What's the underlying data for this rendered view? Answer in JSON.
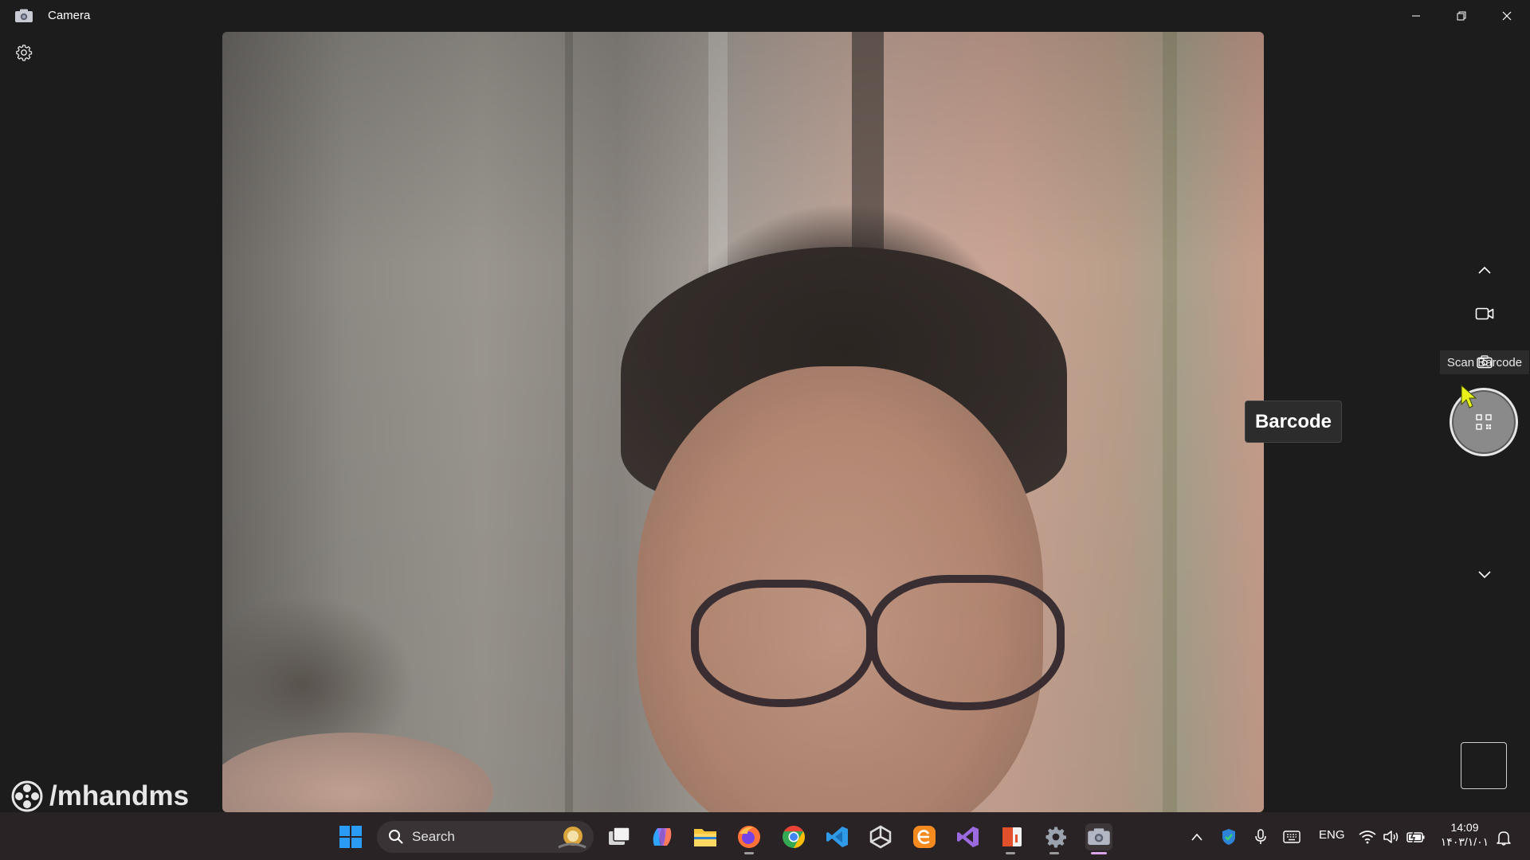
{
  "window": {
    "title": "Camera",
    "controls": [
      "minimize",
      "restore",
      "close"
    ]
  },
  "toolbar": {
    "settings_icon": "gear-icon"
  },
  "camera_preview": {
    "description_icon": "camera-feed"
  },
  "sidebar": {
    "collapse_up_icon": "chevron-up-icon",
    "video_mode_icon": "video-camera-icon",
    "photo_mode_icon": "camera-icon",
    "scan_label": "Scan Barcode",
    "tooltip": "Barcode",
    "shutter_icon": "qr-code-icon",
    "expand_down_icon": "chevron-down-icon",
    "last_capture_thumbnail": ""
  },
  "watermark": {
    "text": "/mhandms"
  },
  "taskbar": {
    "search_placeholder": "Search",
    "apps": [
      {
        "name": "start",
        "icon": "windows-icon",
        "color": "#2b9cf5"
      },
      {
        "name": "task-view",
        "icon": "task-view-icon",
        "color": "#d6d6d6"
      },
      {
        "name": "copilot",
        "icon": "copilot-icon",
        "color": "#7a6cf2"
      },
      {
        "name": "file-explorer",
        "icon": "folder-icon",
        "color": "#f4c43a"
      },
      {
        "name": "firefox",
        "icon": "firefox-icon",
        "color": "#ff7139"
      },
      {
        "name": "chrome",
        "icon": "chrome-icon",
        "color": "#34a853"
      },
      {
        "name": "vscode",
        "icon": "vscode-icon",
        "color": "#2f9be8"
      },
      {
        "name": "unity",
        "icon": "unity-icon",
        "color": "#dcdcdc"
      },
      {
        "name": "edge-legacy",
        "icon": "orange-e-icon",
        "color": "#f58a1f"
      },
      {
        "name": "visual-studio",
        "icon": "visual-studio-icon",
        "color": "#9b6ade"
      },
      {
        "name": "office",
        "icon": "office-icon",
        "color": "#e2512c"
      },
      {
        "name": "settings",
        "icon": "gear-icon",
        "color": "#9aa3ad"
      },
      {
        "name": "camera",
        "icon": "camera-icon",
        "color": "#b3b7c4"
      }
    ],
    "tray": {
      "language": "ENG",
      "time": "14:09",
      "date": "۱۴۰۳/۱/۰۱"
    }
  }
}
